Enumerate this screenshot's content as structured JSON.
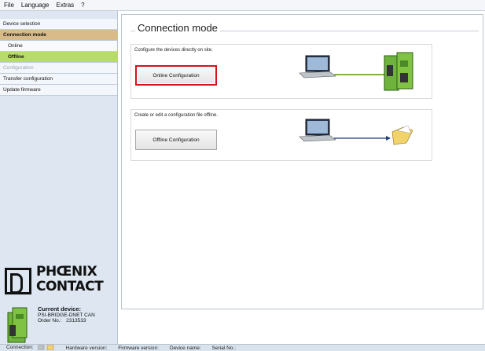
{
  "menu": [
    "File",
    "Language",
    "Extras",
    "?"
  ],
  "sidebar": {
    "items": [
      {
        "label": "Device selection"
      },
      {
        "label": "Connection mode"
      },
      {
        "label": "Online"
      },
      {
        "label": "Offline"
      },
      {
        "label": "Configuration"
      },
      {
        "label": "Transfer configuration"
      },
      {
        "label": "Update firmware"
      }
    ],
    "logo": {
      "line1": "PHŒNIX",
      "line2": "CONTACT"
    },
    "device": {
      "title": "Current device:",
      "name": "PSI-BRIDGE-DNET CAN",
      "order_label": "Order No.:",
      "order_value": "2313533"
    }
  },
  "main": {
    "title": "Connection mode",
    "online_card": {
      "text": "Configure the devices directly on site.",
      "button": "Online Configuration"
    },
    "offline_card": {
      "text": "Create or edit a configuration file offline.",
      "button": "Offline Configuration"
    }
  },
  "statusbar": {
    "connection": "Connection:",
    "hardware": "Hardware version:",
    "firmware": "Firmware version:",
    "device_name": "Device name:",
    "serial": "Serial No.:"
  },
  "colors": {
    "accent_active": "#d9bb8a",
    "accent_selected": "#b8dc6a",
    "highlight_red": "#d5121a"
  }
}
